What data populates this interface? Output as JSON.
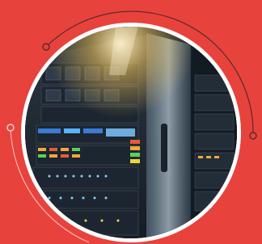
{
  "image": {
    "subject": "server-rack-photo",
    "colors": {
      "background": "#e8423d",
      "ring": "#ffffff",
      "arc_dark": "#5a2a2a",
      "arc_light": "#f7b5b0"
    }
  }
}
